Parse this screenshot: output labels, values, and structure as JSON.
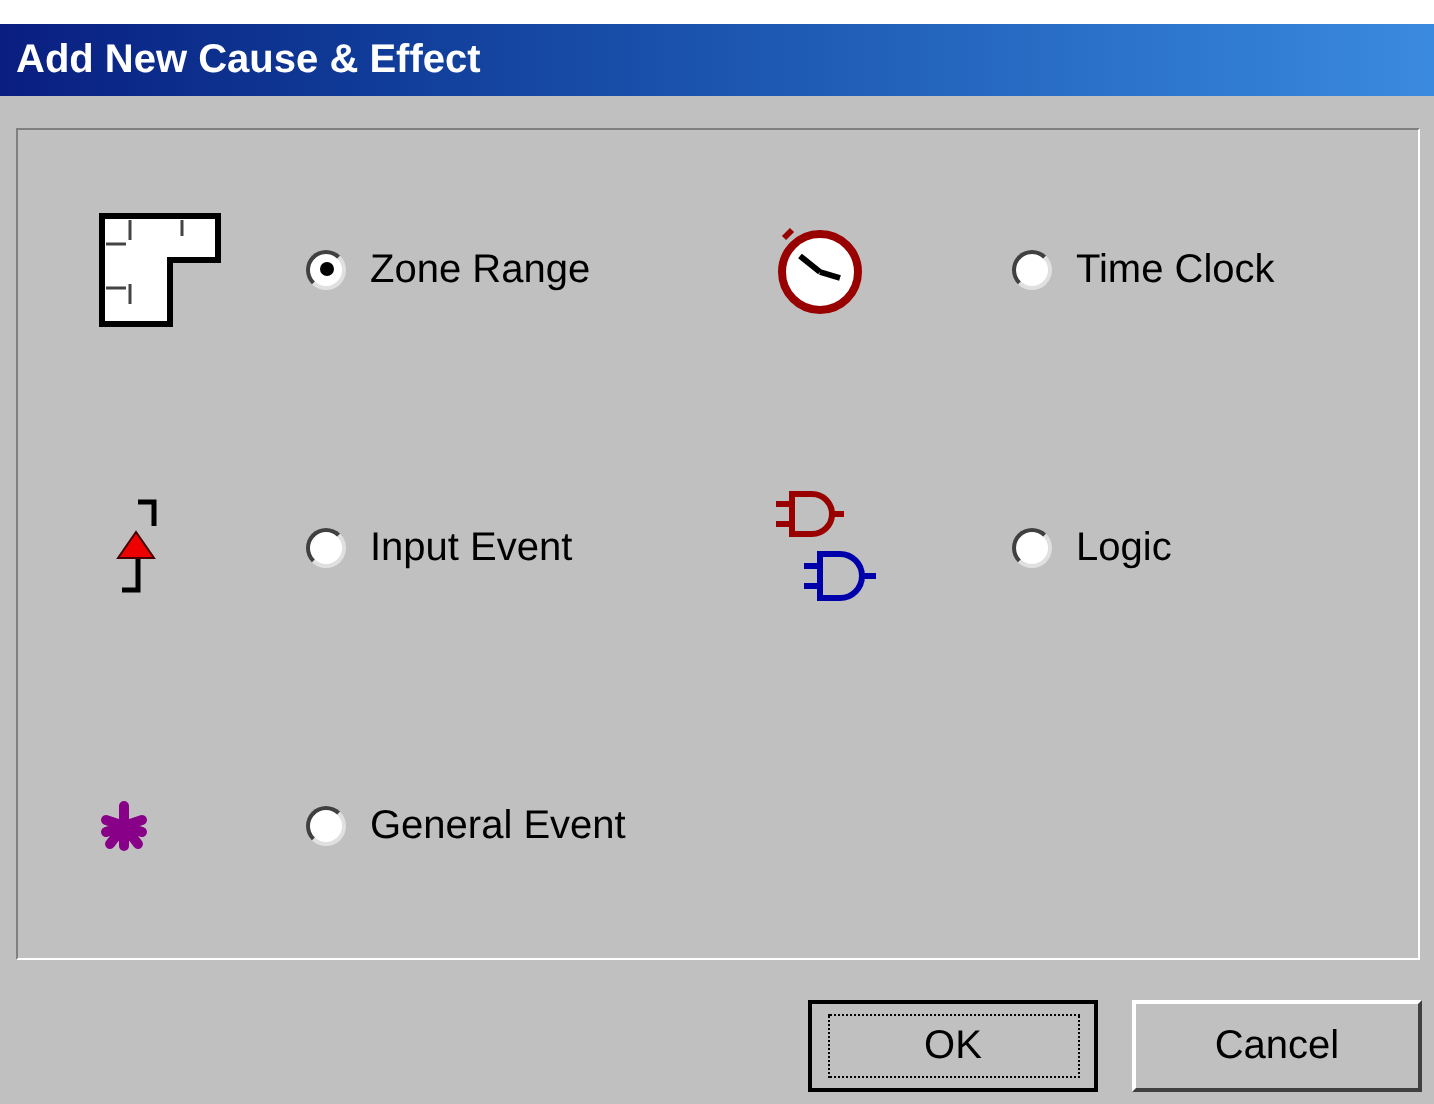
{
  "window": {
    "title": "Add New Cause & Effect"
  },
  "options": [
    {
      "kind": "zone",
      "label": "Zone Range",
      "selected": true
    },
    {
      "kind": "clock",
      "label": "Time Clock",
      "selected": false
    },
    {
      "kind": "input",
      "label": "Input Event",
      "selected": false
    },
    {
      "kind": "logic",
      "label": "Logic",
      "selected": false
    },
    {
      "kind": "general",
      "label": "General Event",
      "selected": false
    }
  ],
  "buttons": [
    {
      "label": "OK",
      "default": true
    },
    {
      "label": "Cancel",
      "default": false
    }
  ]
}
